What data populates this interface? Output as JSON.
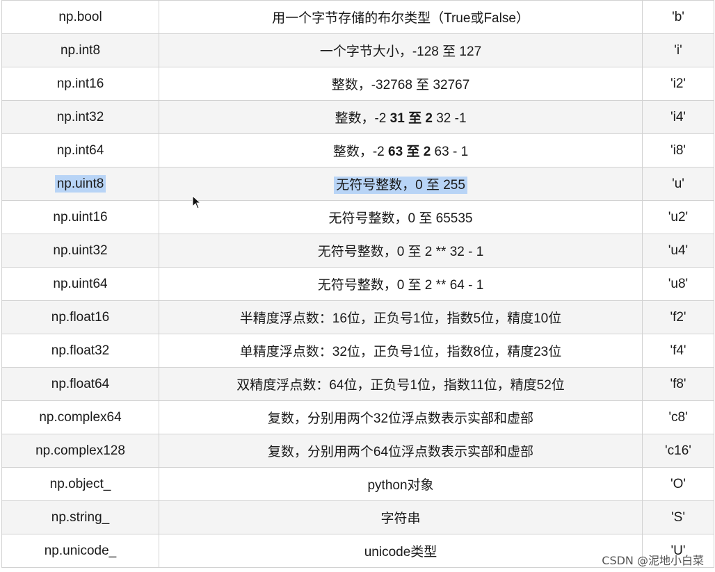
{
  "rows": [
    {
      "type": "np.bool",
      "desc": "用一个字节存储的布尔类型（True或False）",
      "code": "'b'"
    },
    {
      "type": "np.int8",
      "desc": "一个字节大小，-128 至 127",
      "code": "'i'"
    },
    {
      "type": "np.int16",
      "desc": "整数，-32768 至 32767",
      "code": "'i2'"
    },
    {
      "type": "np.int32",
      "desc_a": "整数，-2 ",
      "desc_b": "31 至 2",
      "desc_c": " 32 -1",
      "code": "'i4'"
    },
    {
      "type": "np.int64",
      "desc_a": "整数，-2 ",
      "desc_b": "63 至 2",
      "desc_c": " 63 - 1",
      "code": "'i8'"
    },
    {
      "type": "np.uint8",
      "desc": "无符号整数，0 至 255",
      "code": "'u'"
    },
    {
      "type": "np.uint16",
      "desc": "无符号整数，0 至 65535",
      "code": "'u2'"
    },
    {
      "type": "np.uint32",
      "desc": "无符号整数，0 至 2 ** 32 - 1",
      "code": "'u4'"
    },
    {
      "type": "np.uint64",
      "desc": "无符号整数，0 至 2 ** 64 - 1",
      "code": "'u8'"
    },
    {
      "type": "np.float16",
      "desc": "半精度浮点数：16位，正负号1位，指数5位，精度10位",
      "code": "'f2'"
    },
    {
      "type": "np.float32",
      "desc": "单精度浮点数：32位，正负号1位，指数8位，精度23位",
      "code": "'f4'"
    },
    {
      "type": "np.float64",
      "desc": "双精度浮点数：64位，正负号1位，指数11位，精度52位",
      "code": "'f8'"
    },
    {
      "type": "np.complex64",
      "desc": "复数，分别用两个32位浮点数表示实部和虚部",
      "code": "'c8'"
    },
    {
      "type": "np.complex128",
      "desc": "复数，分别用两个64位浮点数表示实部和虚部",
      "code": "'c16'"
    },
    {
      "type": "np.object_",
      "desc": "python对象",
      "code": "'O'"
    },
    {
      "type": "np.string_",
      "desc": "字符串",
      "code": "'S'"
    },
    {
      "type": "np.unicode_",
      "desc": "unicode类型",
      "code": "'U'"
    }
  ],
  "watermark": "CSDN @泥地小白菜",
  "colors": {
    "selection": "#b8d4f6",
    "border": "#d2d2d2",
    "stripe": "#f4f4f4"
  },
  "icons": {
    "cursor": "arrow-cursor-icon"
  }
}
